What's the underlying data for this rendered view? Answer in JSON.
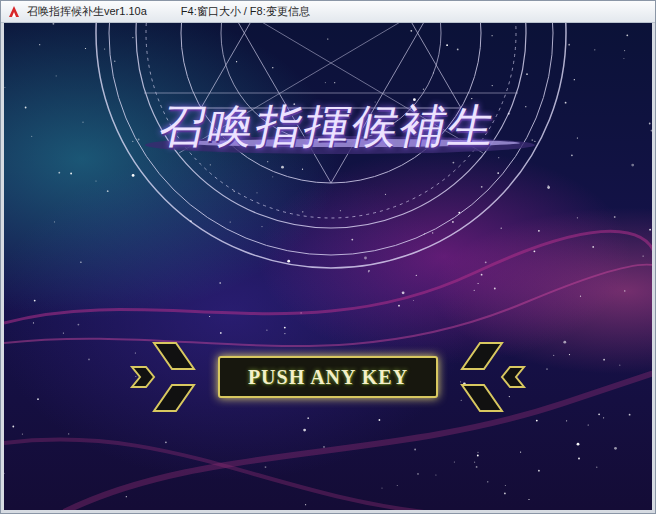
{
  "window": {
    "title": "召唤指挥候补生ver1.10a",
    "hint": "F4:窗口大小 / F8:变更信息"
  },
  "game": {
    "title": "召喚指揮候補生",
    "prompt": "PUSH ANY KEY"
  }
}
